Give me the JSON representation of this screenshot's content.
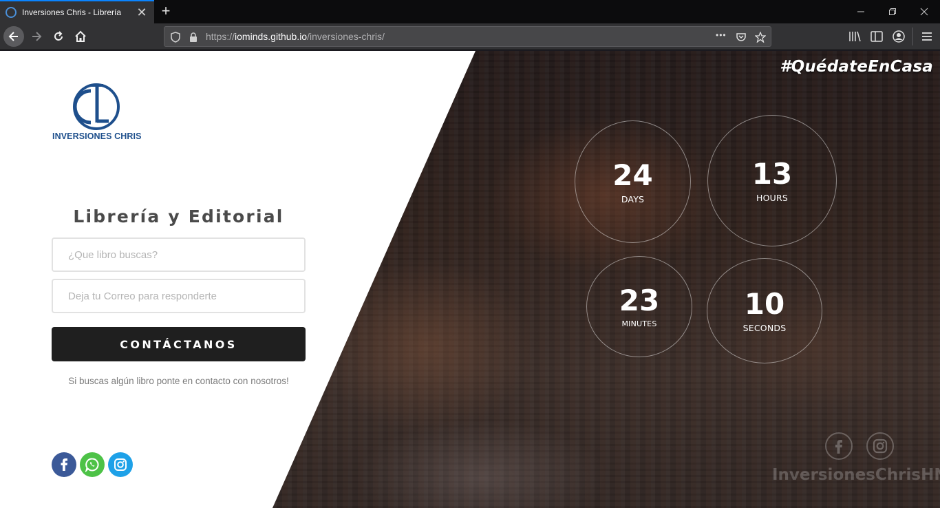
{
  "browser": {
    "tab_title": "Inversiones Chris - Librería",
    "url_prefix": "https://",
    "url_host": "iominds.github.io",
    "url_path": "/inversiones-chris/",
    "new_tab_symbol": "+",
    "close_symbol": "✕",
    "menu_dots": "•••"
  },
  "brand": {
    "logo_text": "INVERSIONES CHRIS",
    "logo_color": "#1e4f8c"
  },
  "left": {
    "headline": "Librería y Editorial",
    "search_placeholder": "¿Que libro buscas?",
    "email_placeholder": "Deja tu Correo para responderte",
    "button_label": "CONTÁCTANOS",
    "helper_text": "Si buscas algún libro ponte en contacto con nosotros!",
    "social": [
      {
        "icon": "facebook-icon",
        "color": "#3b5998"
      },
      {
        "icon": "whatsapp-icon",
        "color": "#4dc247"
      },
      {
        "icon": "instagram-icon",
        "color": "#1ea1e8"
      }
    ]
  },
  "hero": {
    "hashtag": "#QuédateEnCasa",
    "countdown": {
      "days": "24",
      "days_label": "DAYS",
      "hours": "13",
      "hours_label": "HOURS",
      "minutes": "23",
      "minutes_label": "MINUTES",
      "seconds": "10",
      "seconds_label": "SECONDS"
    },
    "watermark": "InversionesChrisHN",
    "social_icons": [
      "facebook-icon",
      "instagram-icon"
    ]
  }
}
